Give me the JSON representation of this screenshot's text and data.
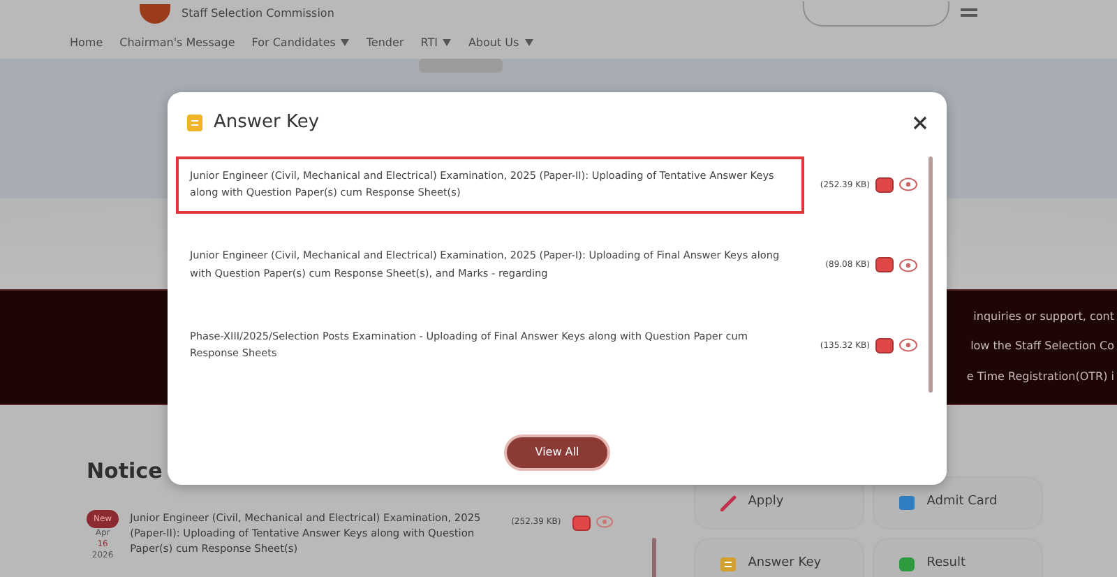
{
  "header": {
    "title": "Staff Selection Commission"
  },
  "nav": [
    {
      "label": "Home",
      "dropdown": false
    },
    {
      "label": "Chairman's Message",
      "dropdown": false
    },
    {
      "label": "For Candidates",
      "dropdown": true
    },
    {
      "label": "Tender",
      "dropdown": false
    },
    {
      "label": "RTI",
      "dropdown": true
    },
    {
      "label": "About Us",
      "dropdown": true
    }
  ],
  "ticker": [
    "inquiries or support, cont",
    "low the Staff Selection Co",
    "e Time Registration(OTR) i"
  ],
  "notice_board": {
    "title": "Notice",
    "items": [
      {
        "badge": "New",
        "month": "Apr",
        "day": "16",
        "year": "2026",
        "text": "Junior Engineer (Civil, Mechanical and Electrical) Examination, 2025 (Paper-II): Uploading of Tentative Answer Keys along with Question Paper(s) cum Response Sheet(s)",
        "size": "(252.39 KB)"
      }
    ]
  },
  "quick_links": [
    {
      "label": "Apply",
      "kind": "apply"
    },
    {
      "label": "Admit Card",
      "kind": "admit"
    },
    {
      "label": "Answer Key",
      "kind": "key"
    },
    {
      "label": "Result",
      "kind": "result"
    }
  ],
  "modal": {
    "title": "Answer Key",
    "items": [
      {
        "text": "Junior Engineer (Civil, Mechanical and Electrical) Examination, 2025 (Paper-II): Uploading of Tentative Answer Keys along with Question Paper(s) cum Response Sheet(s)",
        "size": "(252.39 KB)",
        "selected": true
      },
      {
        "text": "Junior Engineer (Civil, Mechanical and Electrical) Examination, 2025 (Paper-I): Uploading of Final Answer Keys along with Question Paper(s) cum Response Sheet(s), and Marks - regarding",
        "size": "(89.08 KB)",
        "selected": false
      },
      {
        "text": "Phase-XIII/2025/Selection Posts Examination - Uploading of Final Answer Keys along with Question Paper cum Response Sheets",
        "size": "(135.32 KB)",
        "selected": false
      }
    ],
    "button": "View All"
  }
}
